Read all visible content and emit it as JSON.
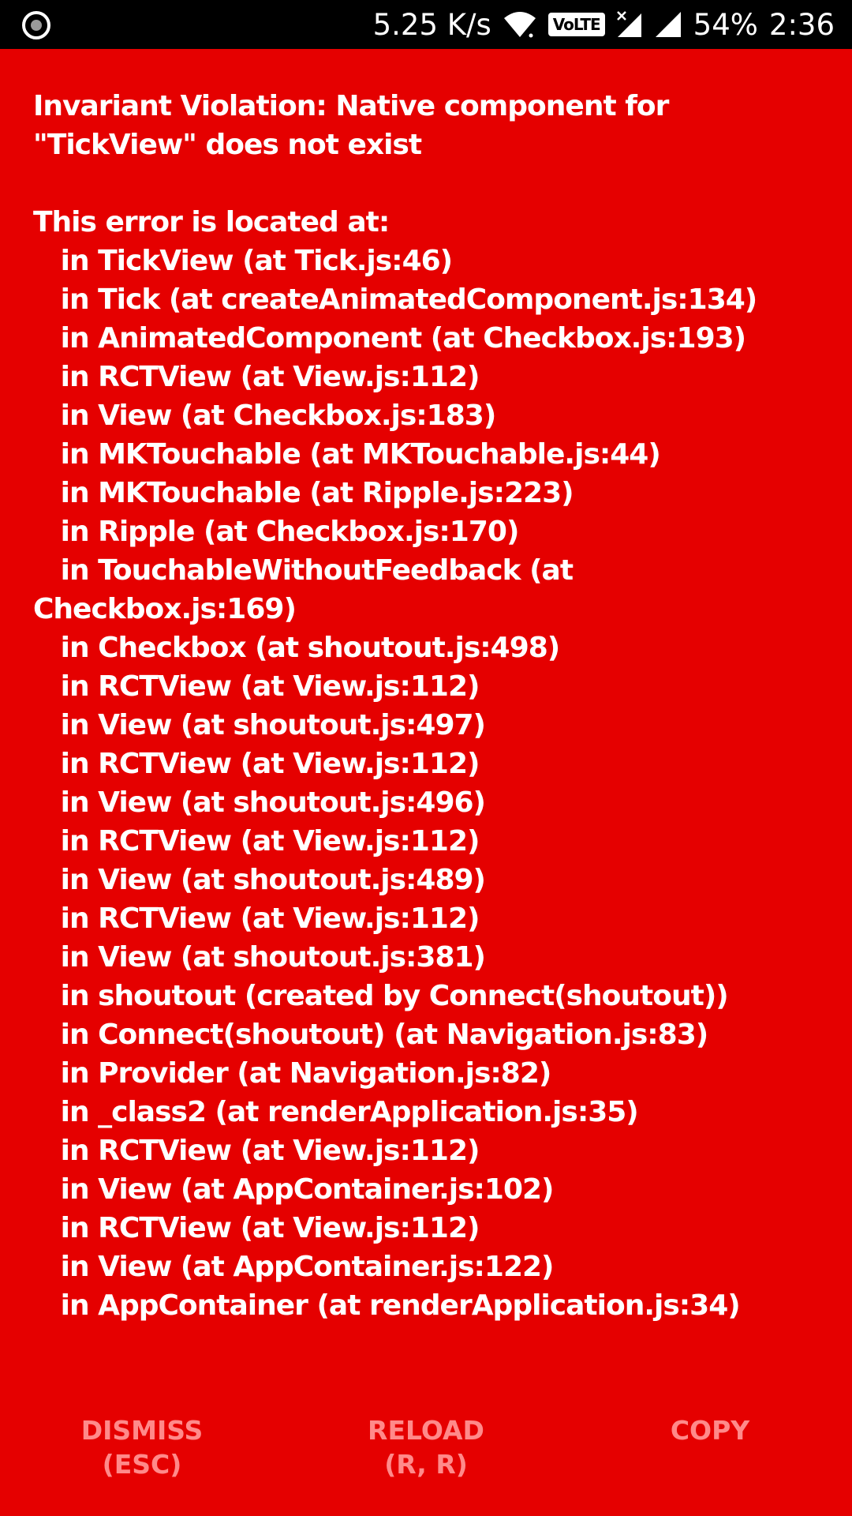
{
  "status_bar": {
    "network_speed": "5.25 K/s",
    "volte_label": "VoLTE",
    "battery": "54%",
    "time": "2:36"
  },
  "error": {
    "title": "Invariant Violation: Native component for\n\"TickView\" does not exist",
    "location_heading": "This error is located at:",
    "stack": [
      "   in TickView (at Tick.js:46)",
      "   in Tick (at createAnimatedComponent.js:134)",
      "   in AnimatedComponent (at Checkbox.js:193)",
      "   in RCTView (at View.js:112)",
      "   in View (at Checkbox.js:183)",
      "   in MKTouchable (at MKTouchable.js:44)",
      "   in MKTouchable (at Ripple.js:223)",
      "   in Ripple (at Checkbox.js:170)",
      "   in TouchableWithoutFeedback (at\nCheckbox.js:169)",
      "   in Checkbox (at shoutout.js:498)",
      "   in RCTView (at View.js:112)",
      "   in View (at shoutout.js:497)",
      "   in RCTView (at View.js:112)",
      "   in View (at shoutout.js:496)",
      "   in RCTView (at View.js:112)",
      "   in View (at shoutout.js:489)",
      "   in RCTView (at View.js:112)",
      "   in View (at shoutout.js:381)",
      "   in shoutout (created by Connect(shoutout))",
      "   in Connect(shoutout) (at Navigation.js:83)",
      "   in Provider (at Navigation.js:82)",
      "   in _class2 (at renderApplication.js:35)",
      "   in RCTView (at View.js:112)",
      "   in View (at AppContainer.js:102)",
      "   in RCTView (at View.js:112)",
      "   in View (at AppContainer.js:122)",
      "   in AppContainer (at renderApplication.js:34)"
    ]
  },
  "buttons": {
    "dismiss": {
      "line1": "DISMISS",
      "line2": "(ESC)"
    },
    "reload": {
      "line1": "RELOAD",
      "line2": "(R, R)"
    },
    "copy": {
      "line1": "COPY"
    }
  },
  "colors": {
    "background": "#e50000",
    "text": "#ffffff",
    "button_text": "#ff8a8a",
    "status_bar": "#000000"
  },
  "icons": {
    "status_left": "record-icon",
    "wifi": "wifi-icon",
    "signal_1": "signal-no-data-icon",
    "signal_2": "signal-icon"
  }
}
